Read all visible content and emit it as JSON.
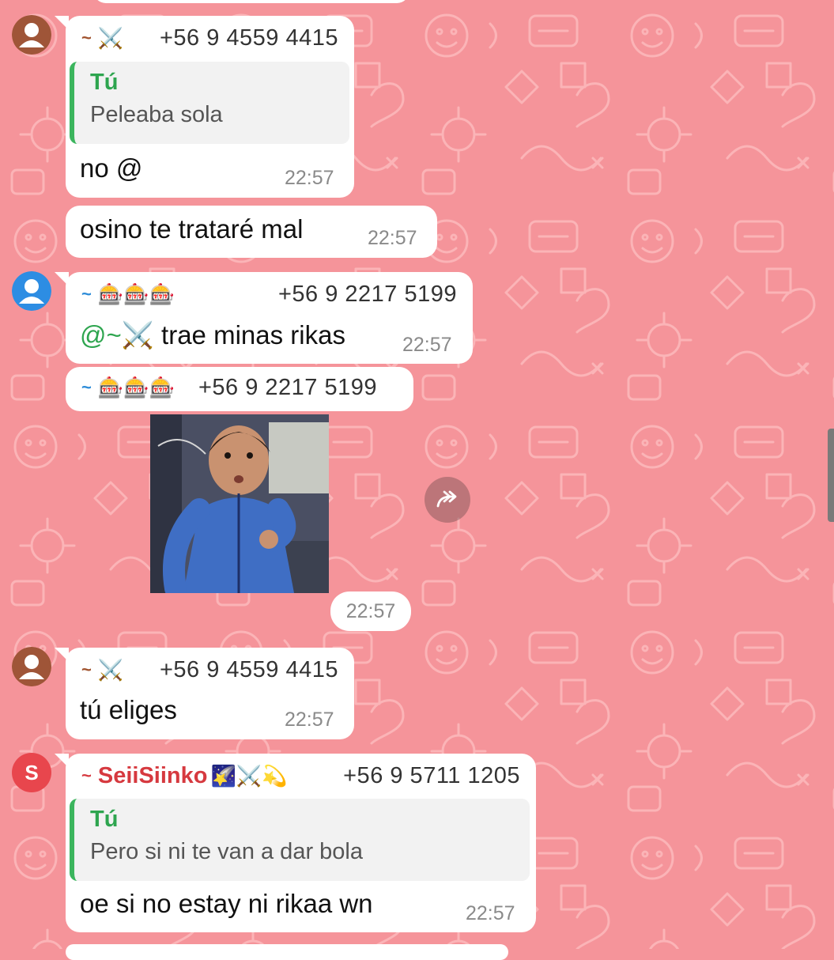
{
  "messages": {
    "m1": {
      "sender_phone": "+56 9 4559 4415",
      "sender_icon": "⚔️",
      "quote_author": "Tú",
      "quote_text": "Peleaba sola",
      "text": "no @",
      "time": "22:57"
    },
    "m2": {
      "text": "osino te trataré mal",
      "time": "22:57"
    },
    "m3": {
      "sender_phone": "+56 9 2217 5199",
      "sender_icons": "🎰🎰🎰",
      "mention": "@~⚔️",
      "text": " trae minas rikas",
      "time": "22:57"
    },
    "m4": {
      "sender_phone": "+56 9 2217 5199",
      "sender_icons": "🎰🎰🎰",
      "time": "22:57"
    },
    "m5": {
      "sender_phone": "+56 9 4559 4415",
      "sender_icon": "⚔️",
      "text": "tú eliges",
      "time": "22:57"
    },
    "m6": {
      "sender_name": "SeiiSiinko",
      "sender_icons": "🌠⚔️💫",
      "sender_phone": "+56 9 5711 1205",
      "avatar_letter": "S",
      "quote_author": "Tú",
      "quote_text": "Pero si ni te van a dar bola",
      "text": "oe si no estay ni rikaa wn",
      "time": "22:57"
    }
  },
  "tilde": "~",
  "colors": {
    "wallpaper": "#f5949a",
    "bubble": "#ffffff",
    "quote_accent": "#3bb55d",
    "mention": "#2ea54f",
    "sender_name": "#d6393f"
  },
  "icons": {
    "forward": "forward-icon",
    "default_avatar": "person-icon"
  }
}
